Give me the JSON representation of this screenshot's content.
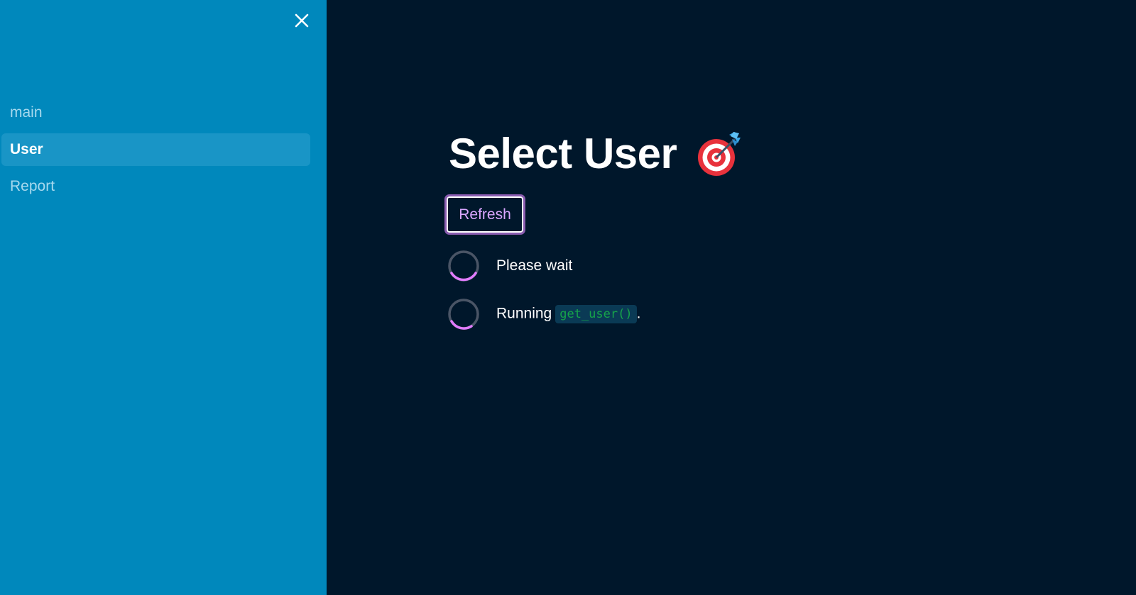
{
  "sidebar": {
    "close_icon": "close-icon",
    "items": [
      {
        "label": "main",
        "active": false
      },
      {
        "label": "User",
        "active": true
      },
      {
        "label": "Report",
        "active": false
      }
    ]
  },
  "main": {
    "title": "Select User",
    "title_icon": "target-dart-icon",
    "refresh_label": "Refresh",
    "status": [
      {
        "text": "Please wait",
        "icon": "spinner-icon"
      },
      {
        "prefix": "Running",
        "code": "get_user()",
        "suffix": ".",
        "icon": "spinner-icon"
      }
    ]
  },
  "colors": {
    "sidebar_bg": "#0088bc",
    "active_item_bg": "#1995c6",
    "main_bg": "#00172b",
    "accent": "#d9a6ff",
    "code_text": "#16a34a"
  }
}
